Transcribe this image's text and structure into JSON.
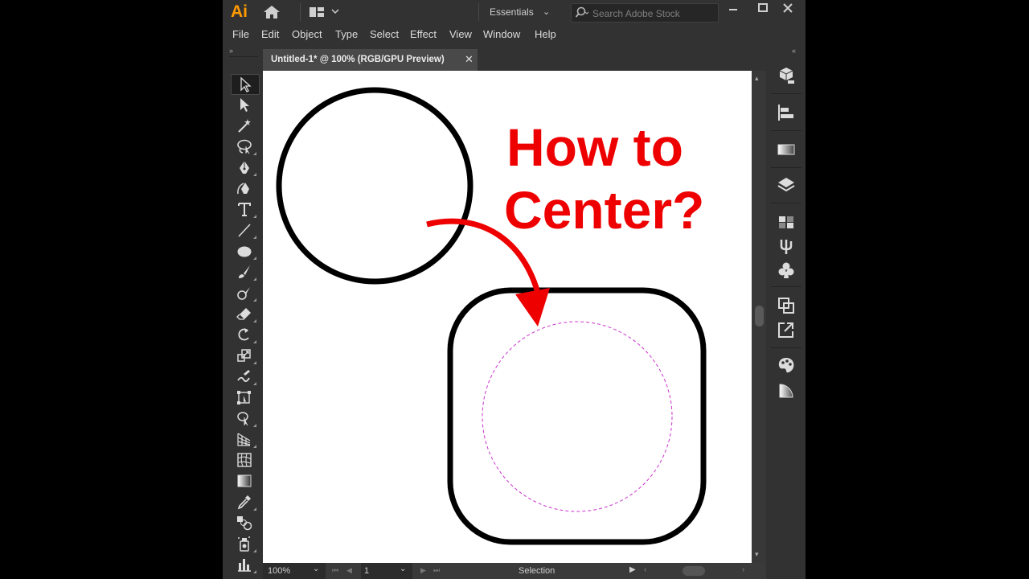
{
  "app": {
    "logo": "Ai",
    "workspace": "Essentials",
    "search_placeholder": "Search Adobe Stock"
  },
  "menu": [
    "File",
    "Edit",
    "Object",
    "Type",
    "Select",
    "Effect",
    "View",
    "Window",
    "Help"
  ],
  "document": {
    "tab_title": "Untitled-1* @ 100% (RGB/GPU Preview)"
  },
  "artwork": {
    "headline_line1": "How to",
    "headline_line2": "Center?"
  },
  "status": {
    "zoom": "100%",
    "artboard": "1",
    "tool": "Selection"
  },
  "colors": {
    "accent_logo": "#ff9a00",
    "headline": "#ee0000",
    "guide": "#cc33cc",
    "app_bg": "#323232"
  },
  "tools": [
    "selection",
    "direct-selection",
    "magic-wand",
    "lasso",
    "pen",
    "curvature",
    "type",
    "line-segment",
    "ellipse",
    "paintbrush",
    "shaper",
    "eraser",
    "rotate",
    "scale",
    "warp",
    "free-transform",
    "shape-builder",
    "perspective-grid",
    "mesh",
    "gradient",
    "eyedropper",
    "blend",
    "symbol-sprayer",
    "column-graph"
  ],
  "right_panels": [
    "libraries",
    "align",
    "transparency",
    "layers",
    "swatches",
    "brushes",
    "symbols",
    "pathfinder",
    "export",
    "color",
    "gradient"
  ]
}
